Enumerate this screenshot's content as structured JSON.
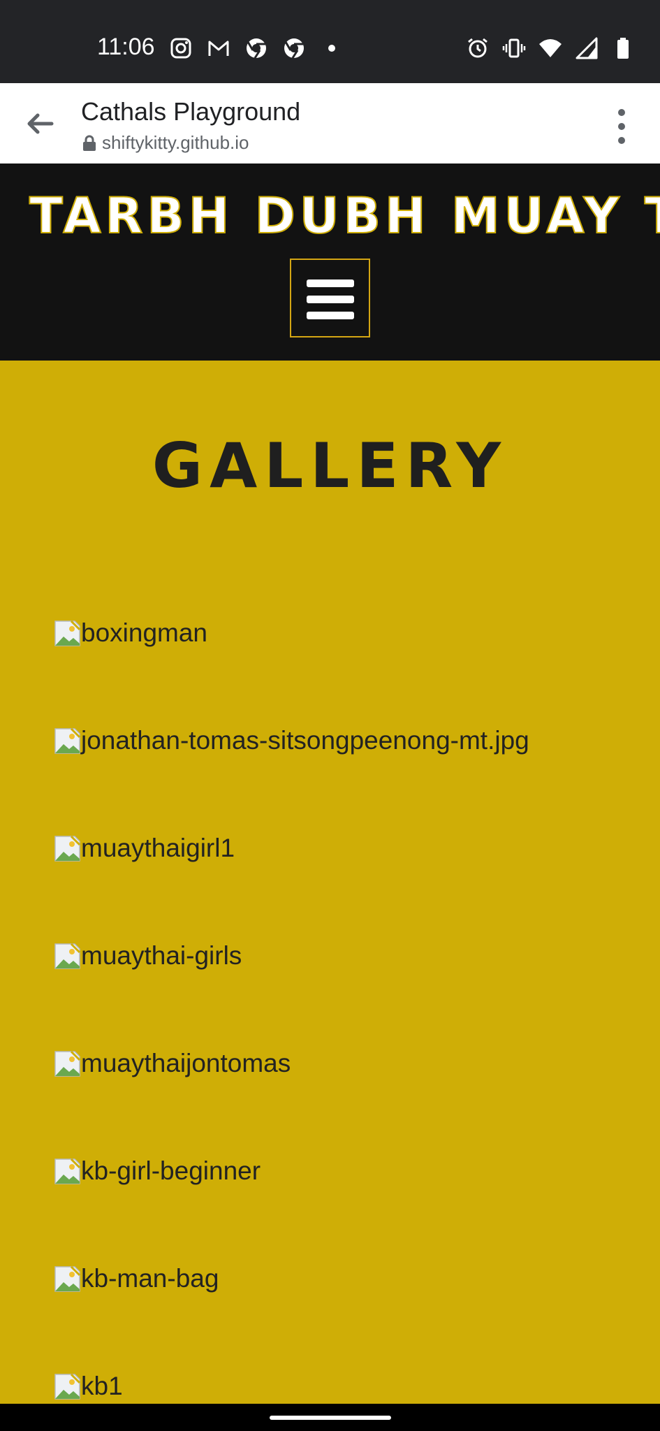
{
  "status_bar": {
    "time": "11:06",
    "left_icons": [
      "instagram-icon",
      "gmail-icon",
      "chrome-icon",
      "chrome-icon",
      "dot-icon"
    ],
    "right_icons": [
      "alarm-icon",
      "vibrate-icon",
      "wifi-icon",
      "signal-icon",
      "battery-icon"
    ]
  },
  "browser": {
    "title": "Cathals Playground",
    "url": "shiftykitty.github.io"
  },
  "site": {
    "brand": "TARBH DUBH MUAY THAI",
    "page_heading": "GALLERY",
    "colors": {
      "background": "#cfae06",
      "header": "#121212",
      "accent": "#d4a613"
    }
  },
  "gallery": {
    "items": [
      "boxingman",
      "jonathan-tomas-sitsongpeenong-mt.jpg",
      "muaythaigirl1",
      "muaythai-girls",
      "muaythaijontomas",
      "kb-girl-beginner",
      "kb-man-bag",
      "kb1"
    ]
  }
}
